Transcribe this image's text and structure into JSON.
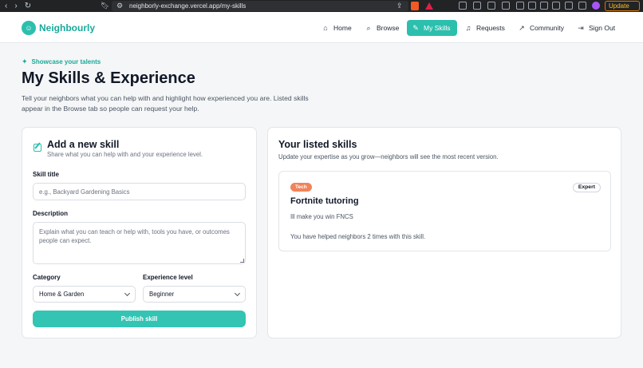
{
  "browser": {
    "url": "neighborly-exchange.vercel.app/my-skills",
    "update_label": "Update"
  },
  "nav": {
    "brand": "Neighbourly",
    "items": [
      {
        "label": "Home",
        "icon": "home-icon"
      },
      {
        "label": "Browse",
        "icon": "search-icon"
      },
      {
        "label": "My Skills",
        "icon": "edit-icon",
        "active": true
      },
      {
        "label": "Requests",
        "icon": "bell-icon"
      },
      {
        "label": "Community",
        "icon": "trend-icon"
      },
      {
        "label": "Sign Out",
        "icon": "sign-out-icon"
      }
    ]
  },
  "header": {
    "eyebrow": "Showcase your talents",
    "title": "My Skills & Experience",
    "description": "Tell your neighbors what you can help with and highlight how experienced you are. Listed skills appear in the Browse tab so people can request your help."
  },
  "form": {
    "title": "Add a new skill",
    "subtitle": "Share what you can help with and your experience level.",
    "skill_title_label": "Skill title",
    "skill_title_placeholder": "e.g., Backyard Gardening Basics",
    "description_label": "Description",
    "description_placeholder": "Explain what you can teach or help with, tools you have, or outcomes people can expect.",
    "category_label": "Category",
    "category_value": "Home & Garden",
    "level_label": "Experience level",
    "level_value": "Beginner",
    "publish_label": "Publish skill"
  },
  "listed": {
    "title": "Your listed skills",
    "subtitle": "Update your expertise as you grow—neighbors will see the most recent version.",
    "skills": [
      {
        "tag": "Tech",
        "level": "Expert",
        "title": "Fortnite tutoring",
        "description": "Ill make you win FNCS",
        "helped": "You have helped neighbors 2 times with this skill."
      }
    ]
  },
  "colors": {
    "accent": "#2cbfad",
    "tag": "#f0845a"
  }
}
